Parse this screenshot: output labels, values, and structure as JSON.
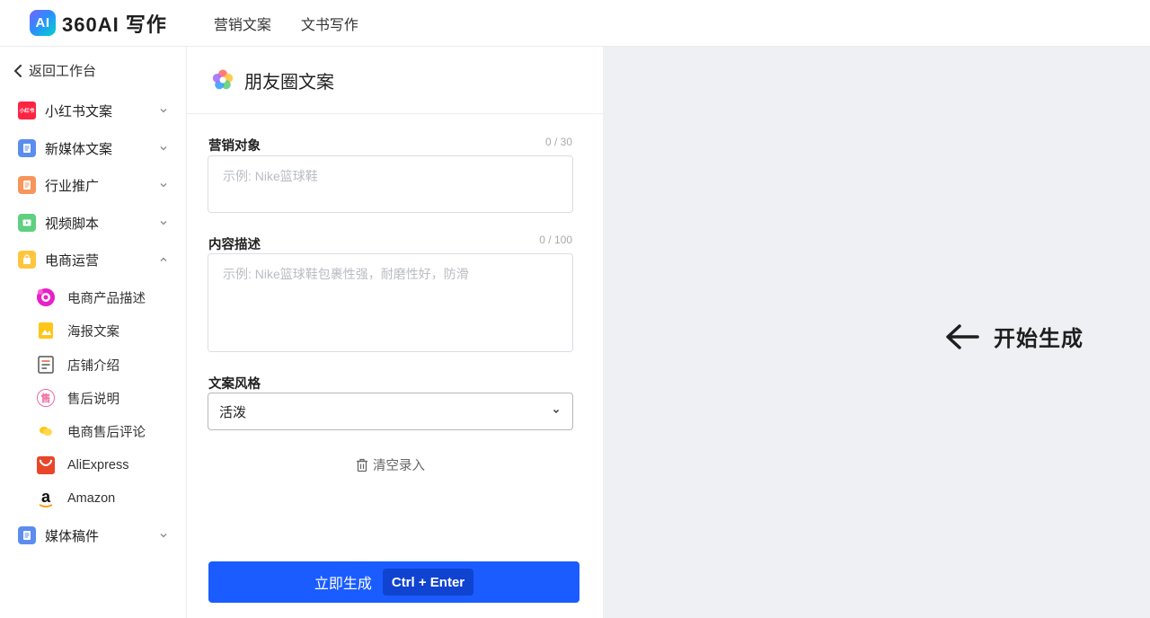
{
  "header": {
    "logo_badge": "AI",
    "logo_text": "360AI 写作",
    "nav": [
      "营销文案",
      "文书写作"
    ]
  },
  "sidebar": {
    "back_label": "返回工作台",
    "categories": [
      {
        "label": "小红书文案",
        "icon_text": "小红书",
        "expanded": false
      },
      {
        "label": "新媒体文案",
        "expanded": false
      },
      {
        "label": "行业推广",
        "expanded": false
      },
      {
        "label": "视频脚本",
        "expanded": false
      },
      {
        "label": "电商运营",
        "expanded": true
      },
      {
        "label": "媒体稿件",
        "expanded": false
      }
    ],
    "subitems": [
      {
        "label": "电商产品描述"
      },
      {
        "label": "海报文案"
      },
      {
        "label": "店铺介绍"
      },
      {
        "label": "售后说明",
        "icon_text": "售"
      },
      {
        "label": "电商售后评论"
      },
      {
        "label": "AliExpress"
      },
      {
        "label": "Amazon",
        "icon_text": "a"
      }
    ]
  },
  "panel": {
    "title": "朋友圈文案",
    "fields": {
      "target": {
        "label": "营销对象",
        "counter": "0 / 30",
        "placeholder": "示例: Nike篮球鞋"
      },
      "description": {
        "label": "内容描述",
        "counter": "0 / 100",
        "placeholder": "示例: Nike篮球鞋包裹性强，耐磨性好，防滑"
      },
      "style": {
        "label": "文案风格",
        "value": "活泼"
      }
    },
    "clear_label": "清空录入",
    "generate_label": "立即生成",
    "shortcut_label": "Ctrl + Enter"
  },
  "result": {
    "start_label": "开始生成"
  },
  "colors": {
    "primary": "#1a5cff",
    "right_bg": "#eef0f4"
  }
}
